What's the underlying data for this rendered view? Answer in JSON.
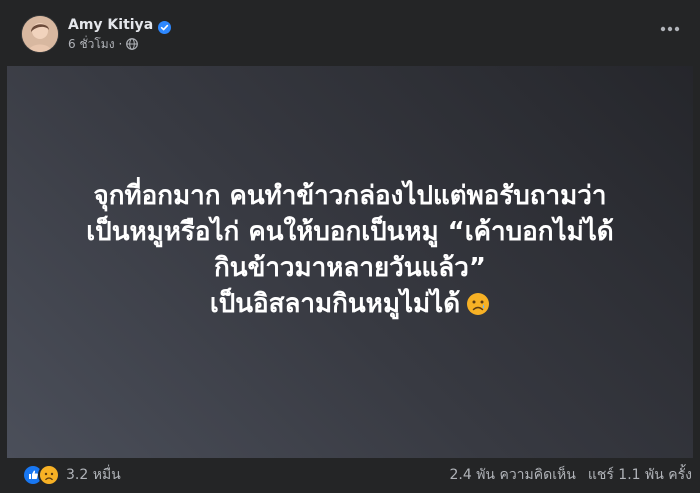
{
  "post": {
    "author_name": "Amy Kitiya",
    "timestamp": "6 ชั่วโมง",
    "dot": "·",
    "text_lines": [
      "จุกที่อกมาก คนทำข้าวกล่องไปแต่พอรับถามว่า",
      "เป็นหมูหรือไก่ คนให้บอกเป็นหมู “เค้าบอกไม่ได้",
      "กินข้าวมาหลายวันแล้ว”",
      "เป็นอิสลามกินหมูไม่ได้"
    ],
    "emoji": "sad-tear-emoji"
  },
  "footer": {
    "reaction_count": "3.2 หมื่น",
    "comments": "2.4 พัน ความคิดเห็น",
    "shares": "แชร์ 1.1 พัน ครั้ง"
  },
  "icons": {
    "verified": "verified-badge-icon",
    "privacy": "globe-icon",
    "more": "more-options-icon",
    "reactions": [
      "like-icon",
      "sad-icon"
    ]
  },
  "colors": {
    "background": "#242526",
    "text_primary": "#e4e6eb",
    "text_secondary": "#b0b3b8",
    "verified": "#2d88ff",
    "like": "#1877f2",
    "sad": "#f7b125"
  }
}
